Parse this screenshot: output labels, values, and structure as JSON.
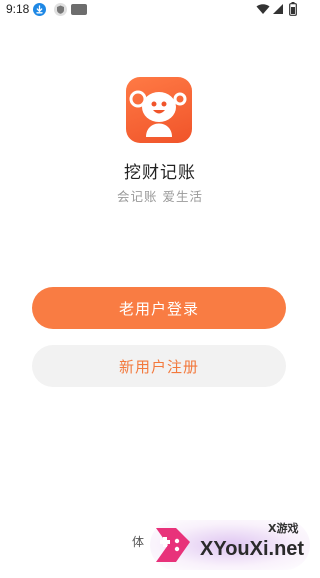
{
  "status_bar": {
    "time": "9:18",
    "icons": [
      "download-icon",
      "shield-icon",
      "nms-icon",
      "wifi-icon",
      "signal-icon",
      "battery-icon"
    ]
  },
  "app": {
    "name": "挖财记账",
    "slogan": "会记账 爱生活",
    "logo_icon": "mascot-icon",
    "brand_color": "#f97c43"
  },
  "buttons": {
    "login_label": "老用户登录",
    "register_label": "新用户注册"
  },
  "footer": {
    "text": "体",
    "watermark_small": "X游戏",
    "watermark_big": "XYouXi.net"
  }
}
